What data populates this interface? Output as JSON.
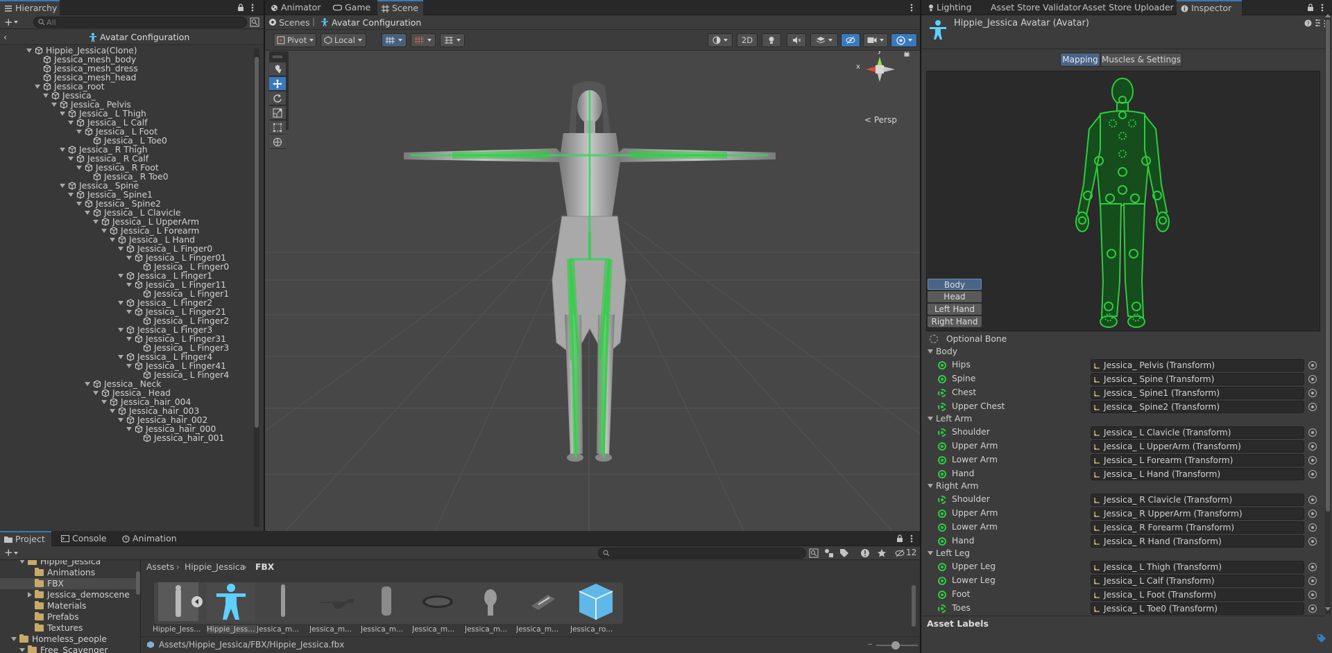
{
  "hierarchy": {
    "tab": "Hierarchy",
    "search_placeholder": "All",
    "header": "Avatar Configuration",
    "rows": [
      {
        "label": "Hippie_Jessica(Clone)",
        "depth": 0,
        "fold": "open"
      },
      {
        "label": "Jessica_mesh_body",
        "depth": 1,
        "fold": "none"
      },
      {
        "label": "Jessica_mesh_dress",
        "depth": 1,
        "fold": "none"
      },
      {
        "label": "Jessica_mesh_head",
        "depth": 1,
        "fold": "none"
      },
      {
        "label": "Jessica_root",
        "depth": 1,
        "fold": "open"
      },
      {
        "label": "Jessica_",
        "depth": 2,
        "fold": "open"
      },
      {
        "label": "Jessica_ Pelvis",
        "depth": 3,
        "fold": "open"
      },
      {
        "label": "Jessica_ L Thigh",
        "depth": 4,
        "fold": "open"
      },
      {
        "label": "Jessica_ L Calf",
        "depth": 5,
        "fold": "open"
      },
      {
        "label": "Jessica_ L Foot",
        "depth": 6,
        "fold": "open"
      },
      {
        "label": "Jessica_ L Toe0",
        "depth": 7,
        "fold": "none"
      },
      {
        "label": "Jessica_ R Thigh",
        "depth": 4,
        "fold": "open"
      },
      {
        "label": "Jessica_ R Calf",
        "depth": 5,
        "fold": "open"
      },
      {
        "label": "Jessica_ R Foot",
        "depth": 6,
        "fold": "open"
      },
      {
        "label": "Jessica_ R Toe0",
        "depth": 7,
        "fold": "none"
      },
      {
        "label": "Jessica_ Spine",
        "depth": 4,
        "fold": "open"
      },
      {
        "label": "Jessica_ Spine1",
        "depth": 5,
        "fold": "open"
      },
      {
        "label": "Jessica_ Spine2",
        "depth": 6,
        "fold": "open"
      },
      {
        "label": "Jessica_ L Clavicle",
        "depth": 7,
        "fold": "open"
      },
      {
        "label": "Jessica_ L UpperArm",
        "depth": 8,
        "fold": "open"
      },
      {
        "label": "Jessica_ L Forearm",
        "depth": 9,
        "fold": "open"
      },
      {
        "label": "Jessica_ L Hand",
        "depth": 10,
        "fold": "open"
      },
      {
        "label": "Jessica_ L Finger0",
        "depth": 11,
        "fold": "open"
      },
      {
        "label": "Jessica_ L Finger01",
        "depth": 12,
        "fold": "open"
      },
      {
        "label": "Jessica_ L Finger0",
        "depth": 13,
        "fold": "none"
      },
      {
        "label": "Jessica_ L Finger1",
        "depth": 11,
        "fold": "open"
      },
      {
        "label": "Jessica_ L Finger11",
        "depth": 12,
        "fold": "open"
      },
      {
        "label": "Jessica_ L Finger1",
        "depth": 13,
        "fold": "none"
      },
      {
        "label": "Jessica_ L Finger2",
        "depth": 11,
        "fold": "open"
      },
      {
        "label": "Jessica_ L Finger21",
        "depth": 12,
        "fold": "open"
      },
      {
        "label": "Jessica_ L Finger2",
        "depth": 13,
        "fold": "none"
      },
      {
        "label": "Jessica_ L Finger3",
        "depth": 11,
        "fold": "open"
      },
      {
        "label": "Jessica_ L Finger31",
        "depth": 12,
        "fold": "open"
      },
      {
        "label": "Jessica_ L Finger3",
        "depth": 13,
        "fold": "none"
      },
      {
        "label": "Jessica_ L Finger4",
        "depth": 11,
        "fold": "open"
      },
      {
        "label": "Jessica_ L Finger41",
        "depth": 12,
        "fold": "open"
      },
      {
        "label": "Jessica_ L Finger4",
        "depth": 13,
        "fold": "none"
      },
      {
        "label": "Jessica_ Neck",
        "depth": 7,
        "fold": "open"
      },
      {
        "label": "Jessica_ Head",
        "depth": 8,
        "fold": "open"
      },
      {
        "label": "Jessica_hair_004",
        "depth": 9,
        "fold": "open"
      },
      {
        "label": "Jessica_hair_003",
        "depth": 10,
        "fold": "open"
      },
      {
        "label": "Jessica_hair_002",
        "depth": 11,
        "fold": "open"
      },
      {
        "label": "Jessica_hair_000",
        "depth": 12,
        "fold": "open"
      },
      {
        "label": "Jessica_hair_001",
        "depth": 13,
        "fold": "none"
      }
    ]
  },
  "scene_tabs": {
    "animator": "Animator",
    "game": "Game",
    "scene": "Scene"
  },
  "breadcrumb": {
    "scenes": "Scenes",
    "current": "Avatar Configuration"
  },
  "scene_toolbar": {
    "pivot": "Pivot",
    "local": "Local",
    "mode_2d": "2D",
    "persp": "< Persp",
    "gizmo_x": "x",
    "gizmo_y": "y"
  },
  "inspector_tabs": {
    "lighting": "Lighting",
    "validator": "Asset Store Validator",
    "uploader": "Asset Store Uploader",
    "inspector": "Inspector"
  },
  "inspector": {
    "title": "Hippie_Jessica Avatar (Avatar)",
    "mapping": "Mapping",
    "muscles": "Muscles & Settings",
    "body_buttons": [
      "Body",
      "Head",
      "Left Hand",
      "Right Hand"
    ],
    "optional_bone": "Optional Bone",
    "sections": [
      {
        "name": "Body",
        "bones": [
          {
            "label": "Hips",
            "value": "Jessica_ Pelvis (Transform)",
            "optional": false
          },
          {
            "label": "Spine",
            "value": "Jessica_ Spine (Transform)",
            "optional": false
          },
          {
            "label": "Chest",
            "value": "Jessica_ Spine1 (Transform)",
            "optional": true
          },
          {
            "label": "Upper Chest",
            "value": "Jessica_ Spine2 (Transform)",
            "optional": true
          }
        ]
      },
      {
        "name": "Left Arm",
        "bones": [
          {
            "label": "Shoulder",
            "value": "Jessica_ L Clavicle (Transform)",
            "optional": true
          },
          {
            "label": "Upper Arm",
            "value": "Jessica_ L UpperArm (Transform)",
            "optional": false
          },
          {
            "label": "Lower Arm",
            "value": "Jessica_ L Forearm (Transform)",
            "optional": false
          },
          {
            "label": "Hand",
            "value": "Jessica_ L Hand (Transform)",
            "optional": false
          }
        ]
      },
      {
        "name": "Right Arm",
        "bones": [
          {
            "label": "Shoulder",
            "value": "Jessica_ R Clavicle (Transform)",
            "optional": true
          },
          {
            "label": "Upper Arm",
            "value": "Jessica_ R UpperArm (Transform)",
            "optional": false
          },
          {
            "label": "Lower Arm",
            "value": "Jessica_ R Forearm (Transform)",
            "optional": false
          },
          {
            "label": "Hand",
            "value": "Jessica_ R Hand (Transform)",
            "optional": false
          }
        ]
      },
      {
        "name": "Left Leg",
        "bones": [
          {
            "label": "Upper Leg",
            "value": "Jessica_ L Thigh (Transform)",
            "optional": false
          },
          {
            "label": "Lower Leg",
            "value": "Jessica_ L Calf (Transform)",
            "optional": false
          },
          {
            "label": "Foot",
            "value": "Jessica_ L Foot (Transform)",
            "optional": false
          },
          {
            "label": "Toes",
            "value": "Jessica_ L Toe0 (Transform)",
            "optional": true
          }
        ]
      }
    ],
    "asset_labels": "Asset Labels"
  },
  "project": {
    "tabs": {
      "project": "Project",
      "console": "Console",
      "animation": "Animation"
    },
    "hidden_count": "12",
    "tree": [
      {
        "label": "Hippie_Jessica",
        "depth": 1,
        "fold": "open",
        "selected": false
      },
      {
        "label": "Animations",
        "depth": 2,
        "fold": "none",
        "selected": false
      },
      {
        "label": "FBX",
        "depth": 2,
        "fold": "none",
        "selected": true
      },
      {
        "label": "Jessica_demoscene",
        "depth": 2,
        "fold": "closed",
        "selected": false
      },
      {
        "label": "Materials",
        "depth": 2,
        "fold": "none",
        "selected": false
      },
      {
        "label": "Prefabs",
        "depth": 2,
        "fold": "none",
        "selected": false
      },
      {
        "label": "Textures",
        "depth": 2,
        "fold": "none",
        "selected": false
      },
      {
        "label": "Homeless_people",
        "depth": 0,
        "fold": "open",
        "selected": false
      },
      {
        "label": "Free_Scavenger",
        "depth": 1,
        "fold": "open",
        "selected": false
      }
    ],
    "path": [
      "Assets",
      "Hippie_Jessica",
      "FBX"
    ],
    "assets": [
      {
        "label": "Hippie_Jess...",
        "icon": "model-thumbnail-icon"
      },
      {
        "label": "Hippie_Jess...",
        "icon": "avatar-icon"
      },
      {
        "label": "Jessica_m...",
        "icon": "mesh-thumbnail-icon"
      },
      {
        "label": "Jessica_m...",
        "icon": "mesh-thumbnail-icon"
      },
      {
        "label": "Jessica_m...",
        "icon": "mesh-thumbnail-icon"
      },
      {
        "label": "Jessica_m...",
        "icon": "mesh-thumbnail-icon"
      },
      {
        "label": "Jessica_m...",
        "icon": "mesh-thumbnail-icon"
      },
      {
        "label": "Jessica_m...",
        "icon": "mesh-thumbnail-icon"
      },
      {
        "label": "Jessica_ro...",
        "icon": "prefab-icon"
      }
    ],
    "status_path": "Assets/Hippie_Jessica/FBX/Hippie_Jessica.fbx"
  },
  "colors": {
    "accent_blue": "#3a79bb",
    "bone_green": "#2ecc40",
    "panel_bg": "#383838",
    "scene_bg": "#474747"
  }
}
